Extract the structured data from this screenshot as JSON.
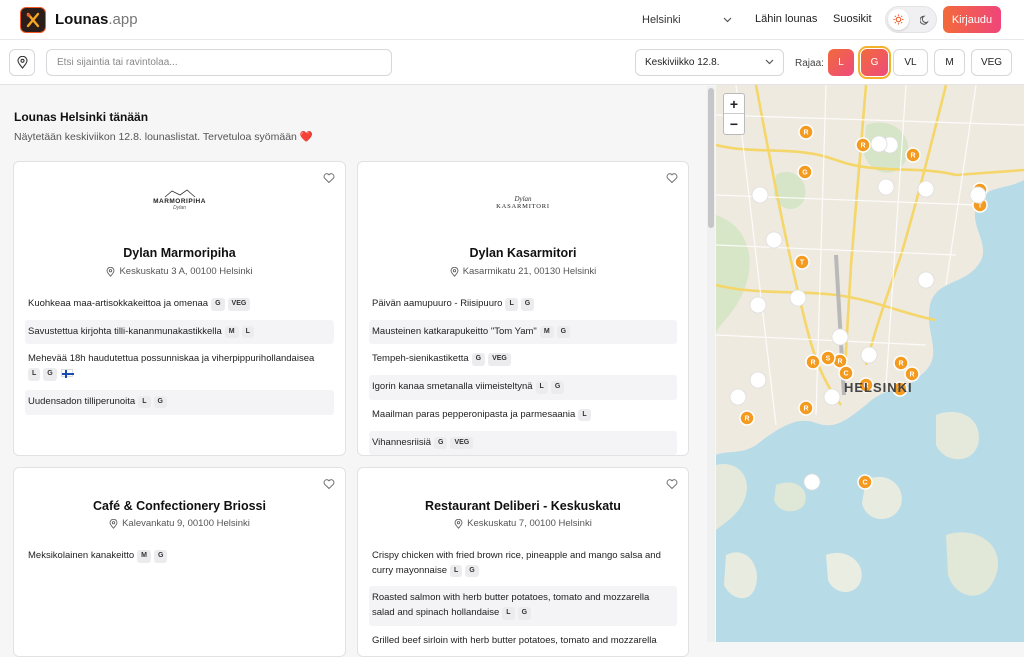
{
  "header": {
    "brand_main": "Lounas",
    "brand_dot": ".app",
    "city": "Helsinki",
    "nav": [
      "Lähin lounas",
      "Suosikit"
    ],
    "login": "Kirjaudu"
  },
  "toolbar": {
    "search_placeholder": "Etsi sijaintia tai ravintolaa...",
    "date": "Keskiviikko 12.8.",
    "filter_label": "Rajaa:",
    "filters": [
      "L",
      "G",
      "VL",
      "M",
      "VEG"
    ]
  },
  "page": {
    "title": "Lounas Helsinki tänään",
    "subtitle": "Näytetään keskiviikon 12.8. lounaslistat. Tervetuloa syömään ❤️"
  },
  "restaurants": [
    {
      "logo_top": "MARMORIPIHA",
      "logo_sub": "Dylan",
      "name": "Dylan Marmoripiha",
      "address": "Keskuskatu 3 A, 00100 Helsinki",
      "items": [
        {
          "text": "Kuohkeaa maa-artisokkakeittoa ja omenaa",
          "tags": [
            "G",
            "VEG"
          ]
        },
        {
          "text": "Savustettua kirjohta tilli-kananmunakastikkella",
          "tags": [
            "M",
            "L"
          ]
        },
        {
          "text": "Mehevää 18h haudutettua possunniskaa ja viherpippurihollandaisea",
          "tags": [
            "L",
            "G"
          ]
        },
        {
          "text": "Uudensadon tilliperunoita",
          "tags": [
            "L",
            "G"
          ]
        }
      ]
    },
    {
      "logo_top": "Dylan",
      "logo_sub": "KASARMITORI",
      "name": "Dylan Kasarmitori",
      "address": "Kasarmikatu 21, 00130 Helsinki",
      "items": [
        {
          "text": "Päivän aamupuuro - Riisipuuro",
          "tags": [
            "L",
            "G"
          ]
        },
        {
          "text": "Mausteinen katkarapukeitto \"Tom Yam\"",
          "tags": [
            "M",
            "G"
          ]
        },
        {
          "text": "Tempeh-sienikastiketta",
          "tags": [
            "G",
            "VEG"
          ]
        },
        {
          "text": "Igorin kanaa smetanalla viimeisteltynä",
          "tags": [
            "L",
            "G"
          ]
        },
        {
          "text": "Maailman paras pepperonipasta ja parmesaania",
          "tags": [
            "L"
          ]
        },
        {
          "text": "Vihannesriisiä",
          "tags": [
            "G",
            "VEG"
          ]
        }
      ]
    },
    {
      "name": "Café & Confectionery Briossi",
      "address": "Kalevankatu 9, 00100 Helsinki",
      "items": [
        {
          "text": "Meksikolainen kanakeitto",
          "tags": [
            "M",
            "G"
          ]
        }
      ]
    },
    {
      "name": "Restaurant Deliberi - Keskuskatu",
      "address": "Keskuskatu 7, 00100 Helsinki",
      "items": [
        {
          "text": "Crispy chicken with fried brown rice, pineapple and mango salsa and curry mayonnaise",
          "tags": [
            "L",
            "G"
          ]
        },
        {
          "text": "Roasted salmon with herb butter potatoes, tomato and mozzarella salad and spinach hollandaise",
          "tags": [
            "L",
            "G"
          ]
        },
        {
          "text": "Grilled beef sirloin with herb butter potatoes, tomato and mozzarella",
          "tags": []
        }
      ]
    }
  ],
  "map": {
    "city_label": "HELSINKI",
    "zoom_in": "+",
    "zoom_out": "−",
    "markers": [
      "R",
      "R",
      "R",
      "T",
      "T",
      "T",
      "R",
      "R",
      "S",
      "R",
      "C",
      "R",
      "R",
      "T",
      "R",
      "R",
      "C",
      "G"
    ]
  },
  "colors": {
    "accent": "#f26a3a",
    "accent2": "#ef4a7d",
    "marker": "#f39a1f"
  }
}
